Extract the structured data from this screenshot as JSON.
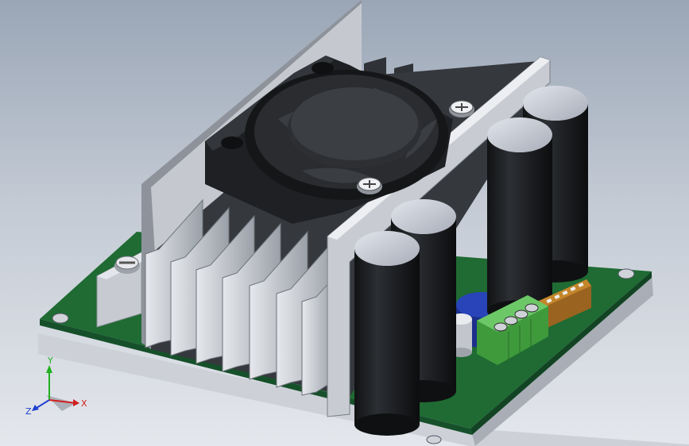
{
  "viewport": {
    "background_top": "#9aa6b6",
    "background_bottom": "#e4e7ec"
  },
  "model": {
    "components": [
      "circuit-board",
      "heatsink",
      "cooling-fan",
      "capacitor",
      "terminal-block",
      "dip-switch",
      "screw"
    ],
    "colors": {
      "pcb": "#1f6b33",
      "metal": "#c9ccd2",
      "heatsink": "#3a3d42",
      "capacitor": "#1d1f22",
      "capacitor_top": "#c8ccd6",
      "blue_cap": "#1f3aa8",
      "terminal": "#57b352",
      "dip_switch": "#c4862a"
    }
  },
  "triad": {
    "x_label": "X",
    "y_label": "Y",
    "z_label": "Z",
    "x_color": "#d02020",
    "y_color": "#20b020",
    "z_color": "#2040d0"
  }
}
